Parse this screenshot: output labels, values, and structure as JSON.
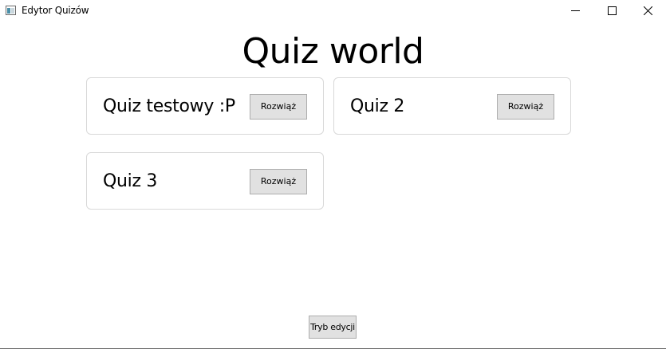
{
  "window": {
    "title": "Edytor Quizów"
  },
  "main": {
    "title": "Quiz world",
    "quizzes": [
      {
        "name": "Quiz testowy :P",
        "solve_label": "Rozwiąż"
      },
      {
        "name": "Quiz 2",
        "solve_label": "Rozwiąż"
      },
      {
        "name": "Quiz 3",
        "solve_label": "Rozwiąż"
      }
    ],
    "edit_mode_label": "Tryb edycji"
  },
  "colors": {
    "button_bg": "#e1e1e1",
    "button_border": "#adadad",
    "card_border": "#d9d9d9"
  },
  "icons": {
    "app": "app-window-icon",
    "minimize": "minimize-icon",
    "maximize": "maximize-icon",
    "close": "close-icon"
  }
}
